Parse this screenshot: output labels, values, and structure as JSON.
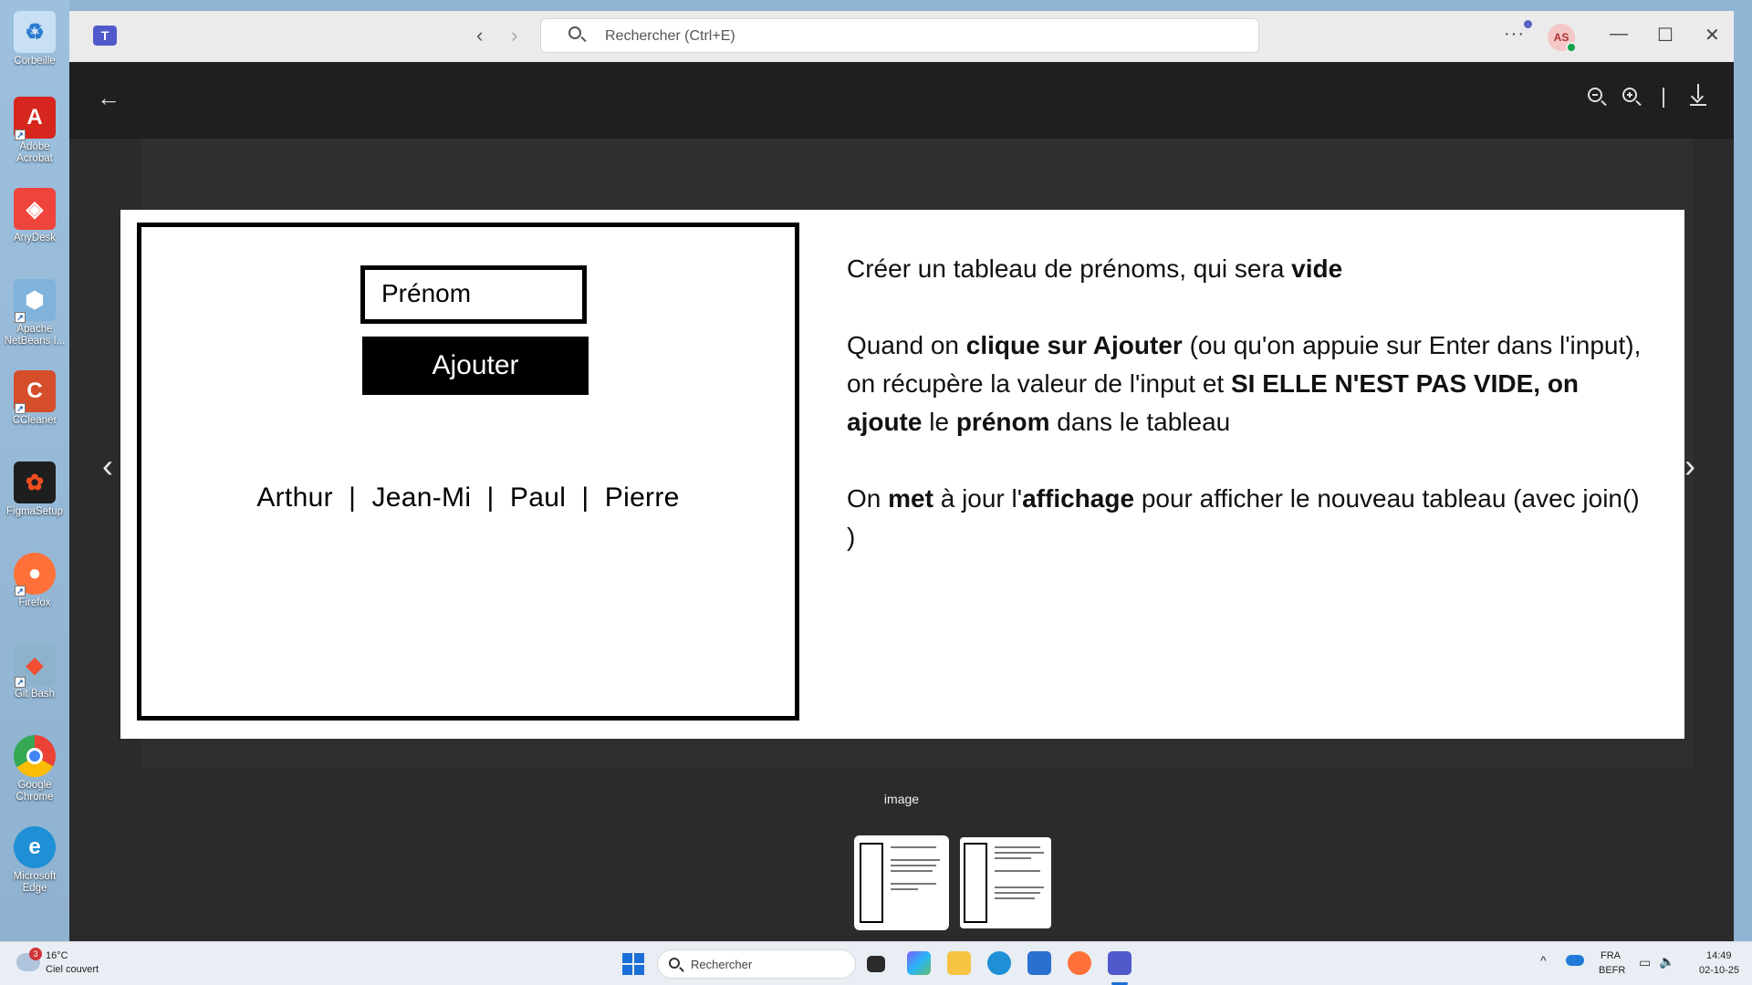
{
  "desktop": {
    "icons": [
      {
        "label": "Corbeille",
        "icon": "recycle-bin-icon",
        "color": "#c9dff3"
      },
      {
        "label": "Adobe Acrobat",
        "icon": "acrobat-icon",
        "color": "#d7261d"
      },
      {
        "label": "AnyDesk",
        "icon": "anydesk-icon",
        "color": "#ef443b"
      },
      {
        "label": "Apache NetBeans I...",
        "icon": "netbeans-icon",
        "color": "#7fb3dc"
      },
      {
        "label": "CCleaner",
        "icon": "ccleaner-icon",
        "color": "#d64d29"
      },
      {
        "label": "FigmaSetup",
        "icon": "figma-icon",
        "color": "#1e1e1e"
      },
      {
        "label": "Firefox",
        "icon": "firefox-icon",
        "color": "#ff7139"
      },
      {
        "label": "Git Bash",
        "icon": "git-bash-icon",
        "color": "#8db2cc"
      },
      {
        "label": "Google Chrome",
        "icon": "chrome-icon",
        "color": "#34a853"
      },
      {
        "label": "Microsoft Edge",
        "icon": "edge-icon",
        "color": "#1f8fd6"
      }
    ]
  },
  "titlebar": {
    "app_icon": "teams-icon",
    "search_placeholder": "Rechercher (Ctrl+E)",
    "avatar_initials": "AS",
    "more_label": "···",
    "minimize": "—",
    "maximize": "☐",
    "close": "✕"
  },
  "viewer": {
    "back_icon": "arrow-left-icon",
    "caption": "image",
    "prev_glyph": "‹",
    "next_glyph": "›"
  },
  "slide": {
    "mock_input_placeholder": "Prénom",
    "mock_button_label": "Ajouter",
    "mock_names": "Arthur  |  Jean-Mi  |  Paul  |  Pierre",
    "p1_a": "Créer un tableau de prénoms, qui sera ",
    "p1_b": "vide",
    "p2_a": "Quand on ",
    "p2_b": "clique sur Ajouter",
    "p2_c": " (ou qu'on appuie sur Enter dans l'input), on récupère la valeur de l'input et ",
    "p2_d": "SI ELLE N'EST PAS VIDE",
    "p2_e": ", on ",
    "p2_f": "ajoute",
    "p2_g": " le ",
    "p2_h": "prénom",
    "p2_i": " dans le tableau",
    "p3_a": "On ",
    "p3_b": "met",
    "p3_c": " à jour l'",
    "p3_d": "affichage",
    "p3_e": " pour afficher le nouveau tableau (avec join() )"
  },
  "taskbar": {
    "weather_temp": "16°C",
    "weather_desc": "Ciel couvert",
    "weather_badge": "3",
    "search_placeholder": "Rechercher",
    "lang_1": "FRA",
    "lang_2": "BEFR",
    "time": "14:49",
    "date": "02-10-25"
  }
}
